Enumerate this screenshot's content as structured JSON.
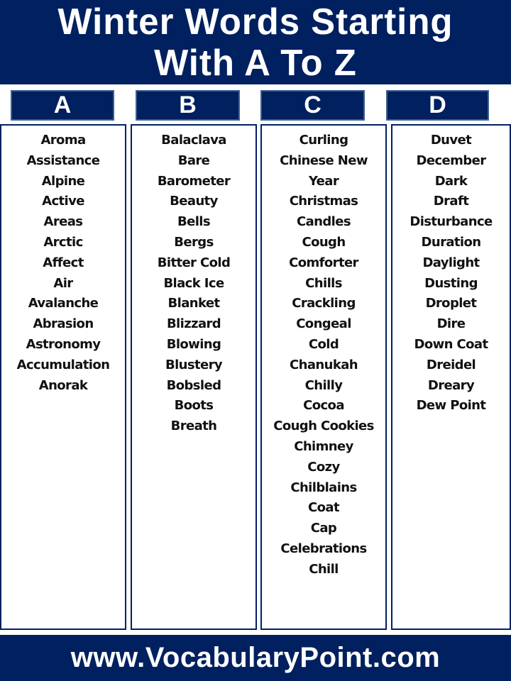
{
  "title": {
    "line1": "Winter Words Starting",
    "line2": "With A To Z"
  },
  "colors": {
    "brand_navy": "#00205f",
    "header_border": "#3d6193",
    "text": "#111111",
    "background": "#ffffff"
  },
  "columns": [
    {
      "letter": "A",
      "words": [
        "Aroma",
        "Assistance",
        "Alpine",
        "Active",
        "Areas",
        "Arctic",
        "Affect",
        "Air",
        "Avalanche",
        "Abrasion",
        "Astronomy",
        "Accumulation",
        "Anorak"
      ]
    },
    {
      "letter": "B",
      "words": [
        "Balaclava",
        "Bare",
        "Barometer",
        "Beauty",
        "Bells",
        "Bergs",
        "Bitter Cold",
        "Black Ice",
        "Blanket",
        "Blizzard",
        "Blowing",
        "Blustery",
        "Bobsled",
        "Boots",
        "Breath"
      ]
    },
    {
      "letter": "C",
      "words": [
        "Curling",
        "Chinese New",
        "Year",
        "Christmas",
        "Candles",
        "Cough",
        "Comforter",
        "Chills",
        "Crackling",
        "Congeal",
        "Cold",
        "Chanukah",
        "Chilly",
        "Cocoa",
        "Cough Cookies",
        "Chimney",
        "Cozy",
        "Chilblains",
        "Coat",
        "Cap",
        "Celebrations",
        "Chill"
      ]
    },
    {
      "letter": "D",
      "words": [
        "Duvet",
        "December",
        "Dark",
        "Draft",
        "Disturbance",
        "Duration",
        "Daylight",
        "Dusting",
        "Droplet",
        "Dire",
        "Down Coat",
        "Dreidel",
        "Dreary",
        "Dew Point"
      ]
    }
  ],
  "footer": {
    "website": "www.VocabularyPoint.com"
  }
}
